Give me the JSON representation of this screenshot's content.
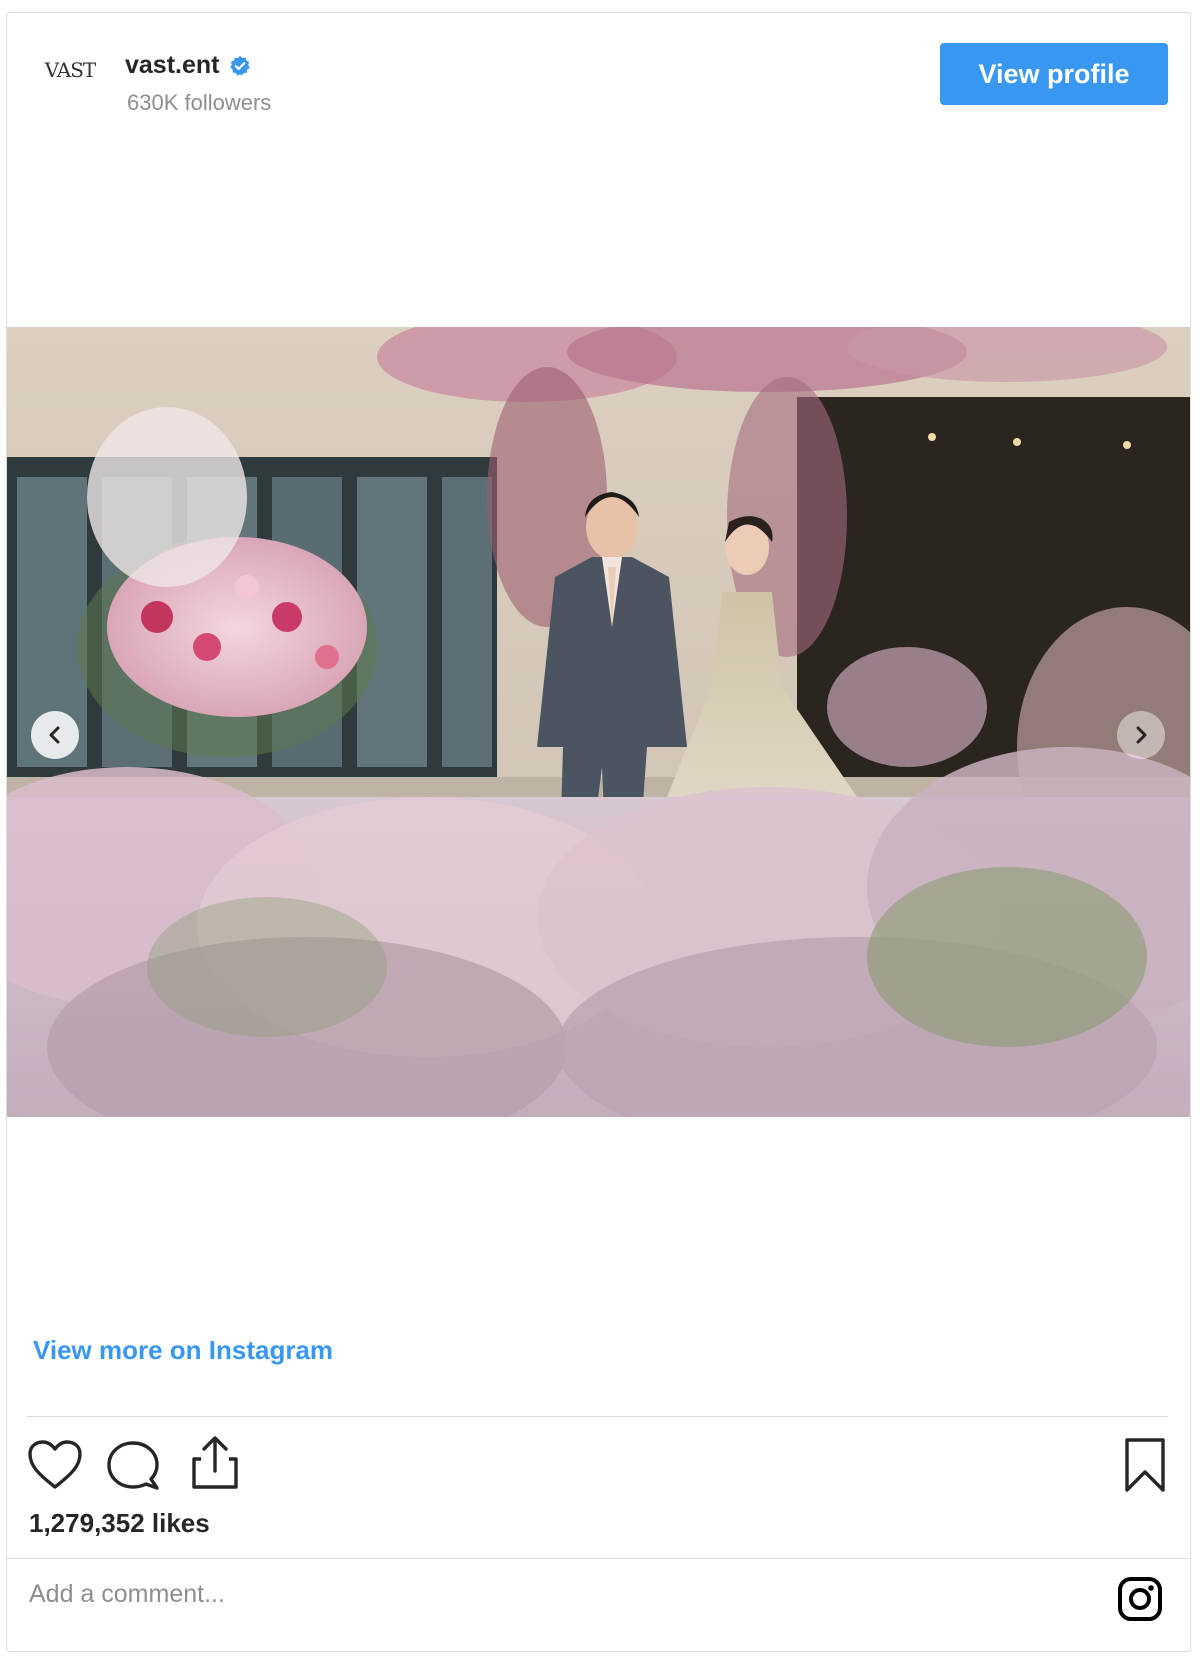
{
  "header": {
    "avatar_text": "VAST",
    "username": "vast.ent",
    "followers": "630K followers",
    "view_profile_label": "View profile"
  },
  "footer": {
    "view_more_label": "View more on Instagram",
    "likes": "1,279,352 likes",
    "comment_placeholder": "Add a comment..."
  },
  "icons": {
    "verified": "verified-badge-icon",
    "prev": "chevron-left-icon",
    "next": "chevron-right-icon",
    "like": "heart-icon",
    "comment": "comment-icon",
    "share": "share-icon",
    "save": "bookmark-icon",
    "brand": "instagram-logo-icon"
  },
  "colors": {
    "accent": "#3897f0",
    "text": "#262626",
    "muted": "#8e8e8e",
    "border": "#dbdbdb"
  }
}
